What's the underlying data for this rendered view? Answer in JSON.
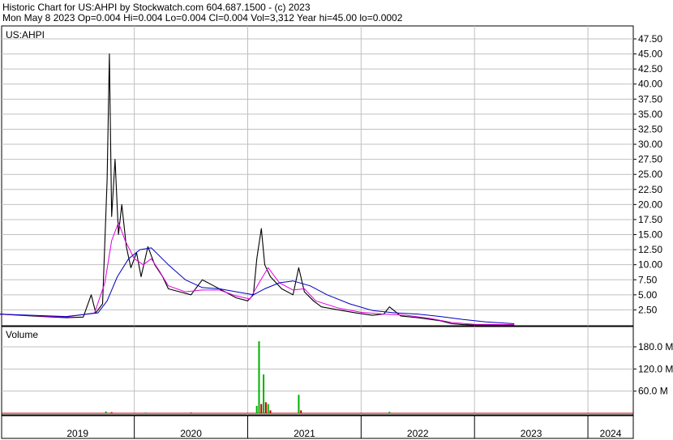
{
  "header": {
    "line1": "Historic Chart for US:AHPI by Stockwatch.com 604.687.1500 - (c) 2023",
    "line2": "Mon May  8 2023   Op=0.004   Hi=0.004   Lo=0.004   Cl=0.004   Vol=3,312   Year hi=45.00   lo=0.0002"
  },
  "colors": {
    "price": "#000000",
    "ma_short": "#e000e0",
    "ma_long": "#0000c0",
    "volume_up": "#00b000",
    "volume_down": "#c00000",
    "grid": "#c0c0c0"
  },
  "chart_data": [
    {
      "type": "line",
      "title": "US:AHPI",
      "x_unit": "year",
      "x_ticks": [
        "2019",
        "2020",
        "2021",
        "2022",
        "2023",
        "2024"
      ],
      "y_ticks": [
        "47.50",
        "45.00",
        "42.50",
        "40.00",
        "37.50",
        "35.00",
        "32.50",
        "30.00",
        "27.50",
        "25.00",
        "22.50",
        "20.00",
        "17.50",
        "15.00",
        "12.50",
        "10.00",
        "7.50",
        "5.00",
        "2.50"
      ],
      "ylim": [
        0,
        48.5
      ],
      "grid": true,
      "series": [
        {
          "role": "price",
          "points": [
            [
              2018.8,
              1.8
            ],
            [
              2019.1,
              1.5
            ],
            [
              2019.4,
              1.2
            ],
            [
              2019.55,
              1.3
            ],
            [
              2019.62,
              5
            ],
            [
              2019.66,
              2
            ],
            [
              2019.72,
              3.5
            ],
            [
              2019.76,
              24
            ],
            [
              2019.78,
              45
            ],
            [
              2019.8,
              18
            ],
            [
              2019.83,
              27.5
            ],
            [
              2019.86,
              15
            ],
            [
              2019.89,
              20
            ],
            [
              2019.93,
              13
            ],
            [
              2019.97,
              9.5
            ],
            [
              2020.02,
              12
            ],
            [
              2020.06,
              8
            ],
            [
              2020.12,
              13
            ],
            [
              2020.18,
              10
            ],
            [
              2020.25,
              8
            ],
            [
              2020.3,
              6
            ],
            [
              2020.4,
              5.5
            ],
            [
              2020.5,
              5
            ],
            [
              2020.6,
              7.5
            ],
            [
              2020.7,
              6.5
            ],
            [
              2020.8,
              5.5
            ],
            [
              2020.9,
              4.5
            ],
            [
              2021.0,
              4
            ],
            [
              2021.05,
              5
            ],
            [
              2021.08,
              11
            ],
            [
              2021.12,
              16
            ],
            [
              2021.15,
              10
            ],
            [
              2021.2,
              8
            ],
            [
              2021.3,
              6
            ],
            [
              2021.4,
              5
            ],
            [
              2021.45,
              9.5
            ],
            [
              2021.5,
              5.5
            ],
            [
              2021.58,
              4
            ],
            [
              2021.65,
              3
            ],
            [
              2021.8,
              2.5
            ],
            [
              2021.95,
              2
            ],
            [
              2022.1,
              1.6
            ],
            [
              2022.2,
              1.8
            ],
            [
              2022.25,
              3
            ],
            [
              2022.35,
              1.5
            ],
            [
              2022.5,
              1.2
            ],
            [
              2022.7,
              0.7
            ],
            [
              2022.8,
              0.2
            ],
            [
              2022.9,
              0.05
            ],
            [
              2023.0,
              0.02
            ],
            [
              2023.1,
              0.02
            ],
            [
              2023.35,
              0.01
            ]
          ]
        },
        {
          "role": "ma_short",
          "points": [
            [
              2018.8,
              1.8
            ],
            [
              2019.4,
              1.3
            ],
            [
              2019.65,
              2
            ],
            [
              2019.74,
              7
            ],
            [
              2019.8,
              14
            ],
            [
              2019.86,
              17
            ],
            [
              2019.92,
              14
            ],
            [
              2020.0,
              11
            ],
            [
              2020.08,
              10
            ],
            [
              2020.15,
              11
            ],
            [
              2020.22,
              9
            ],
            [
              2020.3,
              6.5
            ],
            [
              2020.45,
              5.5
            ],
            [
              2020.6,
              5.8
            ],
            [
              2020.75,
              5.8
            ],
            [
              2020.9,
              4.8
            ],
            [
              2021.02,
              4.3
            ],
            [
              2021.1,
              7
            ],
            [
              2021.18,
              9.5
            ],
            [
              2021.28,
              7
            ],
            [
              2021.4,
              5.8
            ],
            [
              2021.5,
              6
            ],
            [
              2021.6,
              4
            ],
            [
              2021.8,
              2.8
            ],
            [
              2022.0,
              2.1
            ],
            [
              2022.2,
              1.8
            ],
            [
              2022.4,
              1.6
            ],
            [
              2022.6,
              1.1
            ],
            [
              2022.8,
              0.4
            ],
            [
              2023.0,
              0.1
            ],
            [
              2023.35,
              0.05
            ]
          ]
        },
        {
          "role": "ma_long",
          "points": [
            [
              2018.8,
              1.8
            ],
            [
              2019.4,
              1.4
            ],
            [
              2019.68,
              2
            ],
            [
              2019.76,
              4
            ],
            [
              2019.85,
              8
            ],
            [
              2019.95,
              11
            ],
            [
              2020.05,
              12.5
            ],
            [
              2020.15,
              12.8
            ],
            [
              2020.3,
              10
            ],
            [
              2020.45,
              7.5
            ],
            [
              2020.6,
              6.2
            ],
            [
              2020.75,
              6
            ],
            [
              2020.9,
              5.5
            ],
            [
              2021.05,
              5
            ],
            [
              2021.15,
              6
            ],
            [
              2021.28,
              7
            ],
            [
              2021.4,
              7.3
            ],
            [
              2021.55,
              6.5
            ],
            [
              2021.7,
              5
            ],
            [
              2021.9,
              3.5
            ],
            [
              2022.1,
              2.4
            ],
            [
              2022.3,
              2
            ],
            [
              2022.5,
              1.8
            ],
            [
              2022.7,
              1.4
            ],
            [
              2022.9,
              0.9
            ],
            [
              2023.1,
              0.5
            ],
            [
              2023.35,
              0.2
            ]
          ]
        }
      ]
    },
    {
      "type": "bar",
      "title": "Volume",
      "y_ticks": [
        "180.0 M",
        "120.0 M",
        "60.0 M"
      ],
      "ylim": [
        0,
        200
      ],
      "grid": true,
      "bars": [
        {
          "x": 2019.75,
          "value": 5,
          "dir": "up"
        },
        {
          "x": 2019.8,
          "value": 3,
          "dir": "down"
        },
        {
          "x": 2020.1,
          "value": 2,
          "dir": "up"
        },
        {
          "x": 2020.5,
          "value": 2,
          "dir": "down"
        },
        {
          "x": 2021.08,
          "value": 20,
          "dir": "up"
        },
        {
          "x": 2021.1,
          "value": 195,
          "dir": "up"
        },
        {
          "x": 2021.12,
          "value": 25,
          "dir": "down"
        },
        {
          "x": 2021.14,
          "value": 105,
          "dir": "up"
        },
        {
          "x": 2021.16,
          "value": 30,
          "dir": "down"
        },
        {
          "x": 2021.18,
          "value": 25,
          "dir": "up"
        },
        {
          "x": 2021.2,
          "value": 8,
          "dir": "down"
        },
        {
          "x": 2021.45,
          "value": 50,
          "dir": "up"
        },
        {
          "x": 2021.47,
          "value": 8,
          "dir": "down"
        },
        {
          "x": 2022.25,
          "value": 4,
          "dir": "up"
        }
      ]
    }
  ]
}
